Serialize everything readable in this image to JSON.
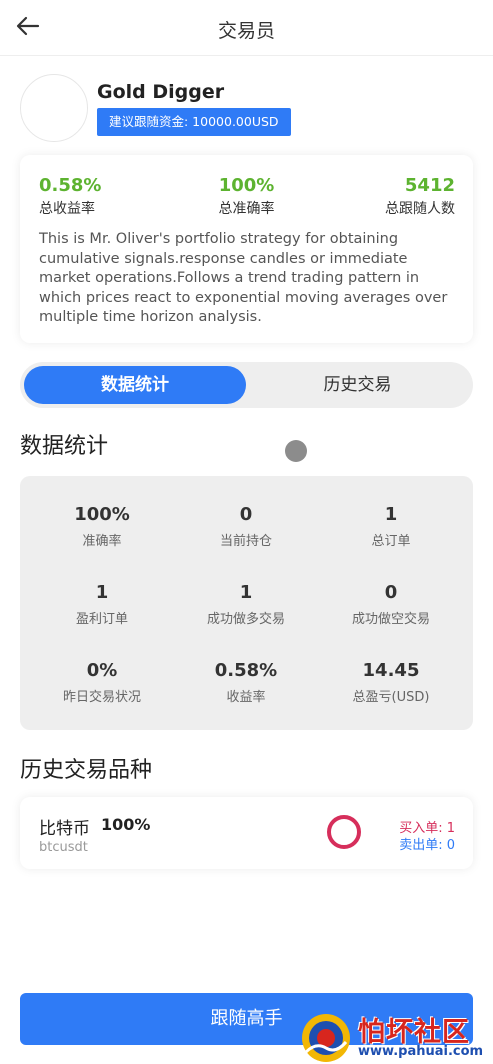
{
  "header": {
    "title": "交易员"
  },
  "trader": {
    "name": "Gold Digger",
    "follow_funds": "建议跟随资金: 10000.00USD"
  },
  "summary": {
    "total_return": {
      "value": "0.58%",
      "label": "总收益率"
    },
    "accuracy": {
      "value": "100%",
      "label": "总准确率"
    },
    "followers": {
      "value": "5412",
      "label": "总跟随人数"
    },
    "description": "This is Mr. Oliver's portfolio strategy for obtaining cumulative signals.response candles or immediate market operations.Follows a trend trading pattern in which prices react to exponential moving averages over multiple time horizon analysis."
  },
  "tabs": [
    {
      "label": "数据统计",
      "active": true
    },
    {
      "label": "历史交易",
      "active": false
    }
  ],
  "stats": {
    "title": "数据统计",
    "cells": [
      {
        "value": "100%",
        "label": "准确率"
      },
      {
        "value": "0",
        "label": "当前持仓"
      },
      {
        "value": "1",
        "label": "总订单"
      },
      {
        "value": "1",
        "label": "盈利订单"
      },
      {
        "value": "1",
        "label": "成功做多交易"
      },
      {
        "value": "0",
        "label": "成功做空交易"
      },
      {
        "value": "0%",
        "label": "昨日交易状况"
      },
      {
        "value": "0.58%",
        "label": "收益率"
      },
      {
        "value": "14.45",
        "label": "总盈亏(USD)"
      }
    ]
  },
  "history": {
    "title": "历史交易品种",
    "items": [
      {
        "name": "比特币",
        "percent": "100%",
        "symbol": "btcusdt",
        "buy": "买入单: 1",
        "sell": "卖出单: 0"
      }
    ]
  },
  "follow_button": "跟随高手",
  "watermark": {
    "title": "怕坏社区",
    "url": "www.pahuai.com"
  },
  "colors": {
    "accent": "#2f7bf6",
    "positive": "#5db330",
    "buy": "#d62e5b",
    "sell": "#2f7bf6"
  },
  "icons": {
    "back": "arrow-left-icon"
  }
}
